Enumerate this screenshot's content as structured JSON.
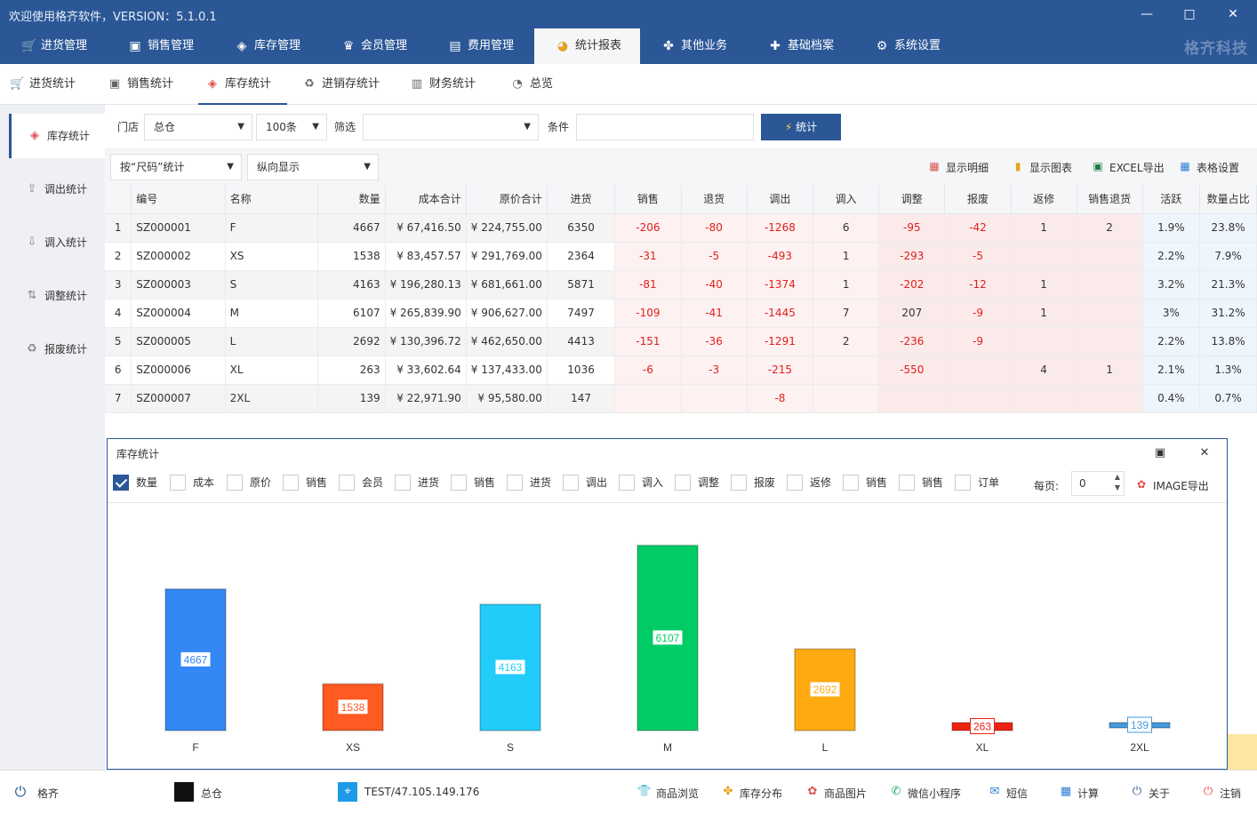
{
  "title_bar": {
    "title": "欢迎使用格齐软件，VERSION：5.1.0.1",
    "minimize": "—",
    "maximize": "□",
    "close": "✕"
  },
  "menu": {
    "items": [
      {
        "label": "进货管理",
        "icon": "cart-icon"
      },
      {
        "label": "销售管理",
        "icon": "sales-icon"
      },
      {
        "label": "库存管理",
        "icon": "box-icon"
      },
      {
        "label": "会员管理",
        "icon": "crown-icon"
      },
      {
        "label": "费用管理",
        "icon": "wallet-icon"
      },
      {
        "label": "统计报表",
        "icon": "pie-icon"
      },
      {
        "label": "其他业务",
        "icon": "grid-icon"
      },
      {
        "label": "基础档案",
        "icon": "puzzle-icon"
      },
      {
        "label": "系统设置",
        "icon": "gear-icon"
      }
    ],
    "active": "统计报表",
    "brand": "格齐科技"
  },
  "subnav": {
    "items": [
      {
        "label": "进货统计"
      },
      {
        "label": "销售统计"
      },
      {
        "label": "库存统计"
      },
      {
        "label": "进销存统计"
      },
      {
        "label": "财务统计"
      },
      {
        "label": "总览"
      }
    ],
    "active": "库存统计"
  },
  "side": {
    "items": [
      {
        "label": "库存统计"
      },
      {
        "label": "调出统计"
      },
      {
        "label": "调入统计"
      },
      {
        "label": "调整统计"
      },
      {
        "label": "报废统计"
      }
    ],
    "active": "库存统计"
  },
  "filters": {
    "store_label": "门店",
    "store_value": "总仓",
    "count_value": "100条",
    "filter_label": "筛选",
    "filter_value": "",
    "cond_label": "条件",
    "cond_value": "",
    "stat_button": "统计",
    "group_value": "按“尺码”统计",
    "direction_value": "纵向显示"
  },
  "toolbar": {
    "show_detail": "显示明细",
    "show_chart": "显示图表",
    "excel_export": "EXCEL导出",
    "table_settings": "表格设置"
  },
  "table": {
    "columns": [
      "",
      "编号",
      "名称",
      "数量",
      "成本合计",
      "原价合计",
      "进货",
      "销售",
      "退货",
      "调出",
      "调入",
      "调整",
      "报废",
      "返修",
      "销售退货",
      "活跃",
      "数量占比"
    ],
    "rows": [
      [
        "1",
        "SZ000001",
        "F",
        "4667",
        "¥ 67,416.50",
        "¥ 224,755.00",
        "6350",
        "-206",
        "-80",
        "-1268",
        "6",
        "-95",
        "-42",
        "1",
        "2",
        "1.9%",
        "23.8%"
      ],
      [
        "2",
        "SZ000002",
        "XS",
        "1538",
        "¥ 83,457.57",
        "¥ 291,769.00",
        "2364",
        "-31",
        "-5",
        "-493",
        "1",
        "-293",
        "-5",
        "",
        "",
        "2.2%",
        "7.9%"
      ],
      [
        "3",
        "SZ000003",
        "S",
        "4163",
        "¥ 196,280.13",
        "¥ 681,661.00",
        "5871",
        "-81",
        "-40",
        "-1374",
        "1",
        "-202",
        "-12",
        "1",
        "",
        "3.2%",
        "21.3%"
      ],
      [
        "4",
        "SZ000004",
        "M",
        "6107",
        "¥ 265,839.90",
        "¥ 906,627.00",
        "7497",
        "-109",
        "-41",
        "-1445",
        "7",
        "207",
        "-9",
        "1",
        "",
        "3%",
        "31.2%"
      ],
      [
        "5",
        "SZ000005",
        "L",
        "2692",
        "¥ 130,396.72",
        "¥ 462,650.00",
        "4413",
        "-151",
        "-36",
        "-1291",
        "2",
        "-236",
        "-9",
        "",
        "",
        "2.2%",
        "13.8%"
      ],
      [
        "6",
        "SZ000006",
        "XL",
        "263",
        "¥ 33,602.64",
        "¥ 137,433.00",
        "1036",
        "-6",
        "-3",
        "-215",
        "",
        "-550",
        "",
        "4",
        "1",
        "2.1%",
        "1.3%"
      ],
      [
        "7",
        "SZ000007",
        "2XL",
        "139",
        "¥ 22,971.90",
        "¥ 95,580.00",
        "147",
        "",
        "",
        "-8",
        "",
        "",
        "",
        "",
        "",
        "0.4%",
        "0.7%"
      ]
    ]
  },
  "chart_panel": {
    "title": "库存统计",
    "checkboxes": [
      {
        "label": "数量",
        "checked": true
      },
      {
        "label": "成本",
        "checked": false
      },
      {
        "label": "原价",
        "checked": false
      },
      {
        "label": "销售",
        "checked": false
      },
      {
        "label": "会员",
        "checked": false
      },
      {
        "label": "进货",
        "checked": false
      },
      {
        "label": "销售",
        "checked": false
      },
      {
        "label": "进货",
        "checked": false
      },
      {
        "label": "调出",
        "checked": false
      },
      {
        "label": "调入",
        "checked": false
      },
      {
        "label": "调整",
        "checked": false
      },
      {
        "label": "报废",
        "checked": false
      },
      {
        "label": "返修",
        "checked": false
      },
      {
        "label": "销售",
        "checked": false
      },
      {
        "label": "销售",
        "checked": false
      },
      {
        "label": "订单",
        "checked": false
      }
    ],
    "per_page_label": "每页:",
    "per_page_value": "0",
    "image_export": "IMAGE导出"
  },
  "chart_data": {
    "type": "bar",
    "title": "",
    "xlabel": "",
    "ylabel": "",
    "categories": [
      "F",
      "XS",
      "S",
      "M",
      "L",
      "XL",
      "2XL"
    ],
    "values": [
      4667,
      1538,
      4163,
      6107,
      2692,
      263,
      139
    ],
    "colors": [
      "#3388f5",
      "#ff5a22",
      "#22ccf8",
      "#00cc66",
      "#ffaa11",
      "#ee2211",
      "#4499dd"
    ],
    "ylim": [
      0,
      6300
    ],
    "grid": false,
    "legend": false
  },
  "status": {
    "user": "格齐",
    "store": "总仓",
    "server": "TEST/47.105.149.176",
    "links": [
      "商品浏览",
      "库存分布",
      "商品图片",
      "微信小程序",
      "短信",
      "计算",
      "关于",
      "注销"
    ]
  }
}
